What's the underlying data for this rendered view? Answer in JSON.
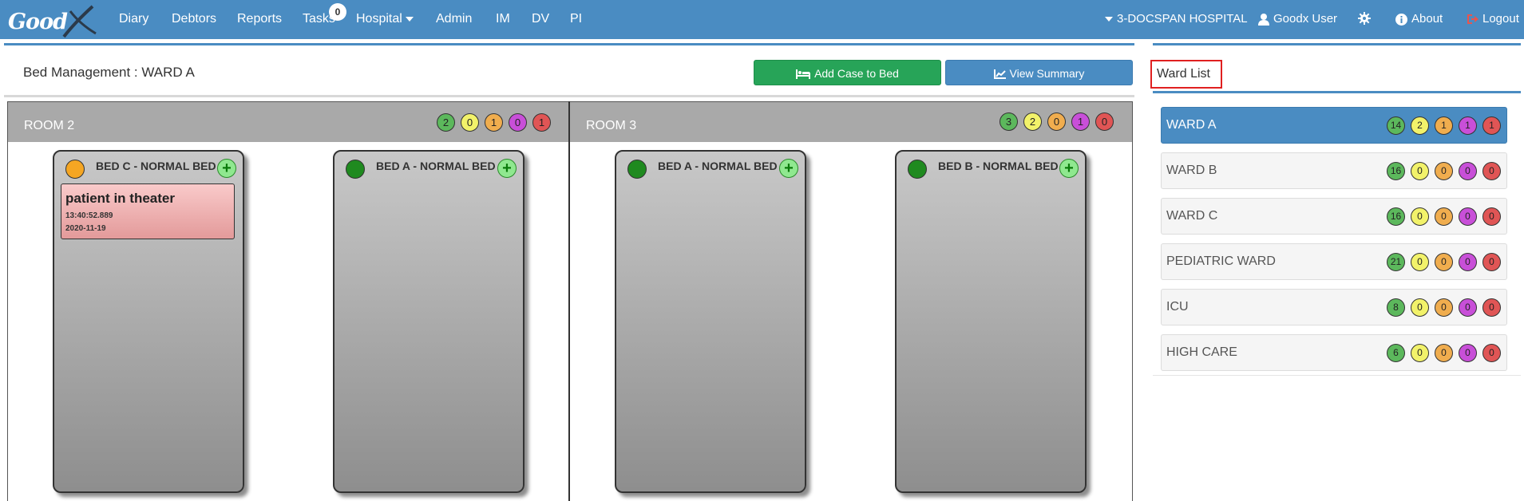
{
  "app": {
    "logo_text": "Good"
  },
  "nav": {
    "items": [
      "Diary",
      "Debtors",
      "Reports",
      "Tasks",
      "Hospital",
      "Admin",
      "IM",
      "DV",
      "PI"
    ],
    "tasks_badge": "0",
    "hospital": "3-DOCSPAN HOSPITAL",
    "user": "Goodx User",
    "about": "About",
    "logout": "Logout"
  },
  "page": {
    "title": "Bed Management : WARD A",
    "add_case_label": "Add Case to Bed",
    "view_summary_label": "View Summary"
  },
  "rooms": [
    {
      "name": "ROOM 2",
      "counts": [
        "2",
        "0",
        "1",
        "0",
        "1"
      ],
      "beds": [
        {
          "title": "BED C - NORMAL BED",
          "status": "orange",
          "case": {
            "name": "patient in theater",
            "time": "13:40:52.889",
            "date": "2020-11-19"
          }
        },
        {
          "title": "BED A - NORMAL BED",
          "status": "green"
        }
      ]
    },
    {
      "name": "ROOM 3",
      "counts": [
        "3",
        "2",
        "0",
        "1",
        "0"
      ],
      "beds": [
        {
          "title": "BED A - NORMAL BED",
          "status": "green"
        },
        {
          "title": "BED B - NORMAL BED",
          "status": "green"
        }
      ]
    }
  ],
  "ward_list": {
    "title": "Ward List",
    "wards": [
      {
        "name": "WARD A",
        "counts": [
          "14",
          "2",
          "1",
          "1",
          "1"
        ],
        "active": true
      },
      {
        "name": "WARD B",
        "counts": [
          "16",
          "0",
          "0",
          "0",
          "0"
        ]
      },
      {
        "name": "WARD C",
        "counts": [
          "16",
          "0",
          "0",
          "0",
          "0"
        ]
      },
      {
        "name": "PEDIATRIC WARD",
        "counts": [
          "21",
          "0",
          "0",
          "0",
          "0"
        ]
      },
      {
        "name": "ICU",
        "counts": [
          "8",
          "0",
          "0",
          "0",
          "0"
        ]
      },
      {
        "name": "HIGH CARE",
        "counts": [
          "6",
          "0",
          "0",
          "0",
          "0"
        ]
      }
    ]
  },
  "colors": {
    "nav": "#4a8cc2",
    "success": "#27a458",
    "count_colors": [
      "#5cb85c",
      "#f2f26a",
      "#f0ad4e",
      "#c84fd8",
      "#e05555"
    ]
  }
}
